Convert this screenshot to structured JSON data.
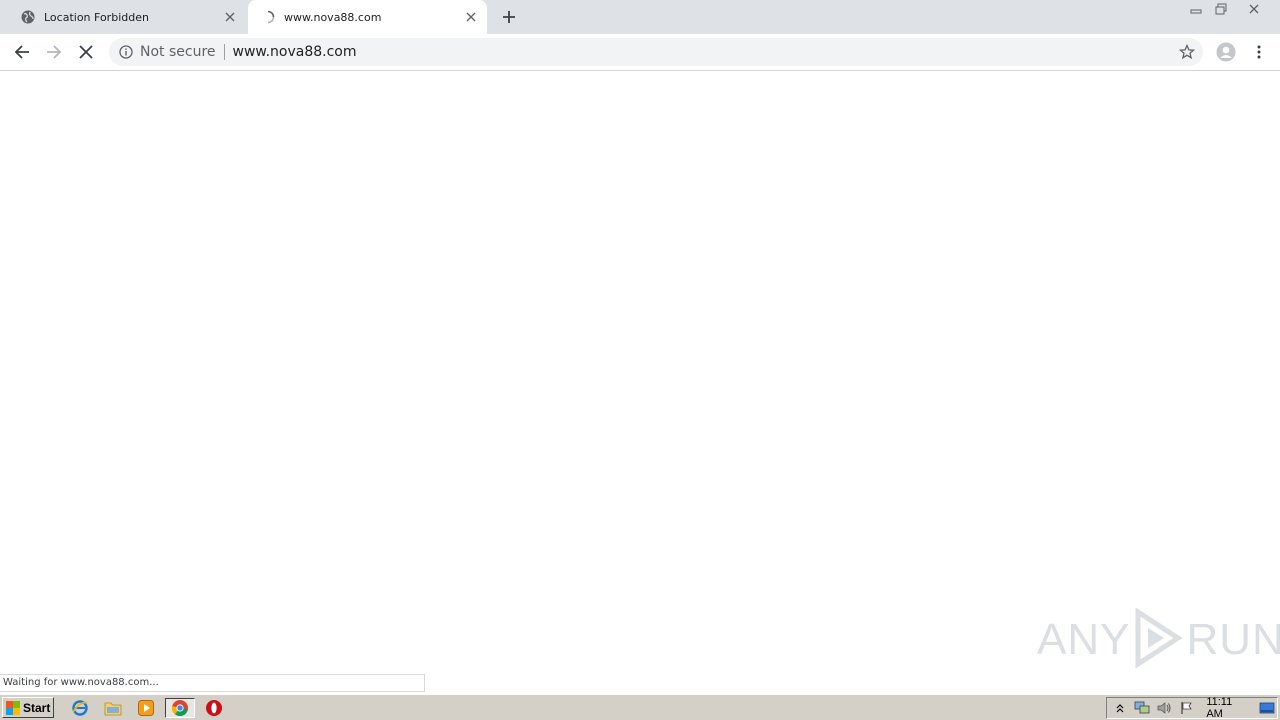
{
  "tabs": [
    {
      "title": "Location Forbidden",
      "icon": "globe-icon",
      "active": false
    },
    {
      "title": "www.nova88.com",
      "icon": "loading-spinner-icon",
      "active": true
    }
  ],
  "toolbar": {
    "security_label": "Not secure",
    "url": "www.nova88.com"
  },
  "status_bar": {
    "text": "Waiting for www.nova88.com..."
  },
  "watermark": {
    "left": "ANY",
    "right": "RUN"
  },
  "taskbar": {
    "start_label": "Start",
    "clock": "11:11 AM",
    "pinned": [
      "internet-explorer-icon",
      "explorer-folder-icon",
      "media-player-icon",
      "chrome-icon",
      "opera-icon"
    ]
  },
  "colors": {
    "tabstrip_bg": "#dee1e6",
    "omnibox_bg": "#f1f3f4",
    "taskbar_bg": "#d4d0c8"
  }
}
